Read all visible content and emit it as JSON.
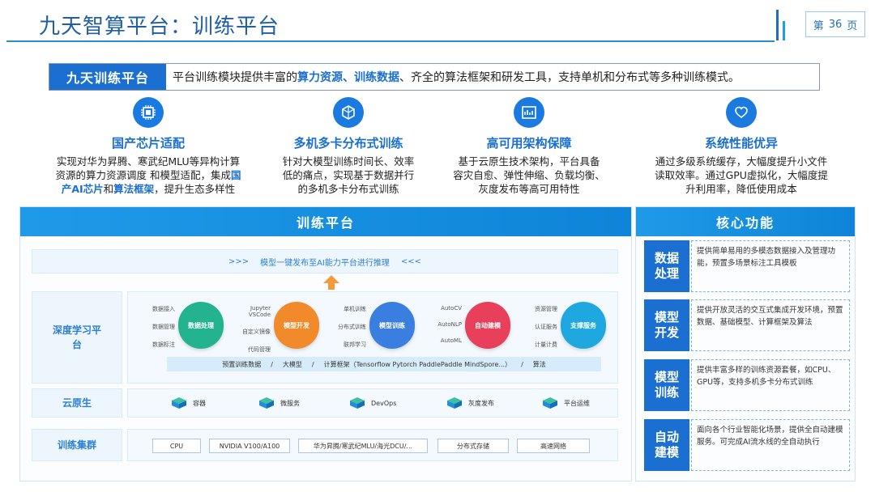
{
  "header": {
    "title": "九天智算平台：训练平台",
    "page_prefix": "第",
    "page_number": "36",
    "page_suffix": "页"
  },
  "intro": {
    "tag": "九天训练平台",
    "text_1": "平台训练模块提供丰富的",
    "highlight_1": "算力资源",
    "sep": "、",
    "highlight_2": "训练数据",
    "text_2": "、齐全的算法框架和研发工具，支持单机和分布式等多种训练模式。"
  },
  "features": [
    {
      "icon": "chip-icon",
      "title": "国产芯片适配",
      "desc_1": "实现对华为昇腾、寒武纪MLU等异构计算",
      "desc_2": "资源的算力资源调度 和模型适配，集成",
      "hl_1": "国",
      "hl_2": "产AI芯片",
      "desc_3": "和",
      "hl_3": "算法框架",
      "desc_4": "，提升生态多样性"
    },
    {
      "icon": "cube-network-icon",
      "title": "多机多卡分布式训练",
      "desc_1": "针对大模型训练时间长、效率",
      "desc_2": "低的痛点，实现基于数据并行",
      "desc_3": "的多机多卡分布式训练"
    },
    {
      "icon": "architecture-icon",
      "title": "高可用架构保障",
      "desc_1": "基于云原生技术架构，平台具备",
      "desc_2": "容灾自愈、弹性伸缩、负载均衡、",
      "desc_3": "灰度发布等高可用特性"
    },
    {
      "icon": "heart-hands-icon",
      "title": "系统性能优异",
      "desc_1": "通过多级系统缓存，大幅度提升小文件",
      "desc_2": "读取效率。通过GPU虚拟化，大幅度提",
      "desc_3": "升利用率，降低使用成本"
    }
  ],
  "platform": {
    "title": "训练平台",
    "ai_bar": "模型一键发布至AI能力平台进行推理",
    "ai_left": ">>>",
    "ai_right": "<<<",
    "rows": {
      "deep_learning": "深度学习平台",
      "cloud_native": "云原生",
      "cluster": "训练集群"
    },
    "dl_groups": [
      {
        "labels": [
          "数据接入",
          "数据管理",
          "数据标注"
        ],
        "pill": "数据处理",
        "color": "#23b38f"
      },
      {
        "labels": [
          "Jupyter VSCode",
          "自定义镜像",
          "代码管理"
        ],
        "pill": "模型开发",
        "color": "#f08a2a"
      },
      {
        "labels": [
          "单机训练",
          "分布式训练",
          "联邦学习"
        ],
        "pill": "模型训练",
        "color": "#3a7fe0"
      },
      {
        "labels": [
          "AutoCV",
          "AutoNLP",
          "AutoML"
        ],
        "pill": "自动建模",
        "color": "#e8405a"
      },
      {
        "labels": [
          "资源管理",
          "认证服务",
          "计量计费"
        ],
        "pill": "支撑服务",
        "color": "#1fa8e0"
      }
    ],
    "framework": {
      "items": [
        "预置训练数据",
        "/",
        "大模型",
        "/",
        "计算框架（Tensorflow Pytorch PaddlePaddle MindSpore...）",
        "/",
        "算法"
      ]
    },
    "cloud_items": [
      "容器",
      "微服务",
      "DevOps",
      "灰度发布",
      "平台运维"
    ],
    "cluster_items": [
      "CPU",
      "NVIDIA V100/A100",
      "华为昇腾/寒武纪MLU/海光DCU/...",
      "分布式存储",
      "高速网络"
    ]
  },
  "core": {
    "title": "核心功能",
    "items": [
      {
        "label": "数据处理",
        "desc": "提供简单易用的多模态数据接入及管理功能，预置多场景标注工具模板"
      },
      {
        "label": "模型开发",
        "desc": "提供开放灵活的交互式集成开发环境，预置数据、基础模型、计算框架及算法"
      },
      {
        "label": "模型训练",
        "desc": "提供丰富多样的训练资源套餐，如CPU、GPU等，支持多机多卡分布式训练"
      },
      {
        "label": "自动建模",
        "desc": "面向各个行业智能化场景，提供全自动建模服务。可完成AI流水线的全自动执行"
      }
    ]
  },
  "colors": {
    "brand": "#1a6fd0",
    "header_blue": "#1f9ae8"
  }
}
